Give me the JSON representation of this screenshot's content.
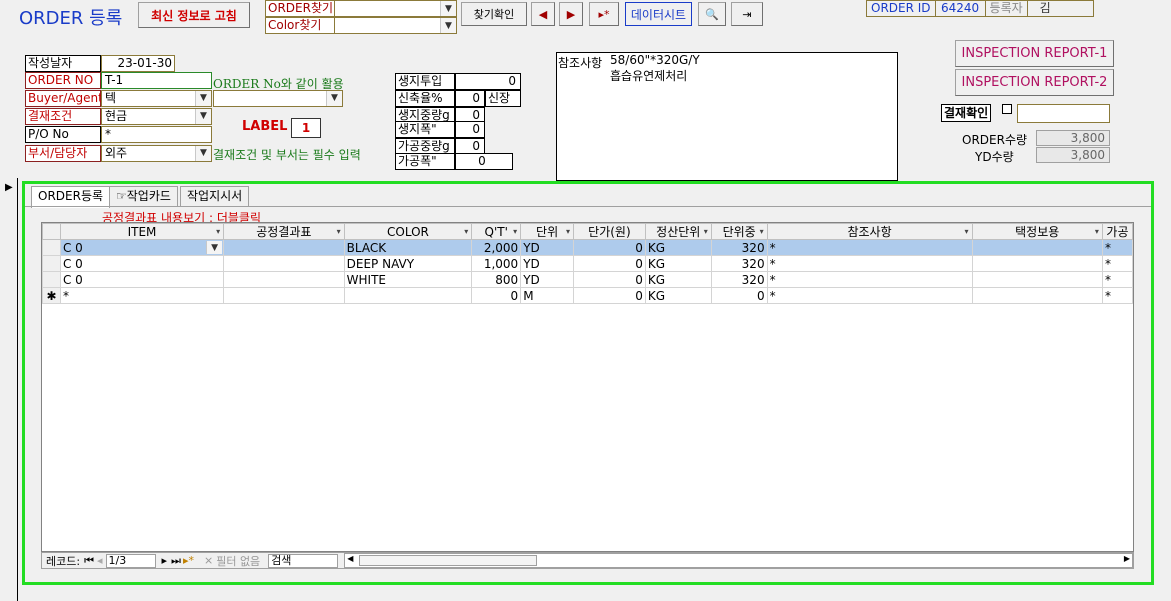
{
  "header": {
    "title": "ORDER 등록",
    "refresh_label": "최신 정보로 고침",
    "order_find_label": "ORDER찾기",
    "color_find_label": "Color찾기",
    "find_confirm_label": "찾기확인",
    "datasheet_label": "데이터시트",
    "order_id_label": "ORDER ID",
    "order_id_value": "64240",
    "registrant_label": "등록자",
    "registrant_value": "김"
  },
  "form": {
    "date_label": "작성날자",
    "date_value": "23-01-30",
    "order_no_label": "ORDER NO",
    "order_no_value": "T-1",
    "order_no_note": "ORDER No와 같이 활용",
    "buyer_label": "Buyer/Agent",
    "buyer_value": "텍",
    "payment_label": "결재조건",
    "payment_value": "현금",
    "po_label": "P/O No",
    "po_value": "*",
    "dept_label": "부서/담당자",
    "dept_value": "외주",
    "required_note": "결재조건 및 부서는 필수 입력",
    "label_text": "LABEL",
    "label_value": "1"
  },
  "spec": {
    "items": [
      {
        "label": "생지투입",
        "value": "0"
      },
      {
        "label": "신축율%",
        "value": "0",
        "extra": "신장"
      },
      {
        "label": "생지중량g",
        "value": "0"
      },
      {
        "label": "생지폭\"",
        "value": "0"
      },
      {
        "label": "가공중량g",
        "value": "0"
      },
      {
        "label": "가공폭\"",
        "value": "0"
      }
    ]
  },
  "remarks": {
    "label": "참조사항",
    "line1": "58/60\"*320G/Y",
    "line2": "흡습유연제처리"
  },
  "right": {
    "report1": "INSPECTION REPORT-1",
    "report2": "INSPECTION REPORT-2",
    "approval_label": "결재확인",
    "order_qty_label": "ORDER수량",
    "order_qty_value": "3,800",
    "yd_qty_label": "YD수량",
    "yd_qty_value": "3,800"
  },
  "tabs": [
    {
      "label": "ORDER등록"
    },
    {
      "label": "작업카드"
    },
    {
      "label": "작업지시서"
    }
  ],
  "grid": {
    "hint": "공정결과표 내용보기 : 더블클릭",
    "columns": [
      "ITEM",
      "공정결과표",
      "COLOR",
      "Q'T'",
      "단위",
      "단가(원)",
      "정산단위",
      "단위중",
      "참조사항",
      "택정보용",
      "가공"
    ],
    "rows": [
      {
        "item": "C 0",
        "process": "",
        "color": "BLACK",
        "qty": "2,000",
        "unit": "YD",
        "price": "0",
        "settle": "KG",
        "weight": "320",
        "remark": "*",
        "tag": "",
        "proc2": "*"
      },
      {
        "item": "C 0",
        "process": "",
        "color": "DEEP NAVY",
        "qty": "1,000",
        "unit": "YD",
        "price": "0",
        "settle": "KG",
        "weight": "320",
        "remark": "*",
        "tag": "",
        "proc2": "*"
      },
      {
        "item": "C 0",
        "process": "",
        "color": "WHITE",
        "qty": "800",
        "unit": "YD",
        "price": "0",
        "settle": "KG",
        "weight": "320",
        "remark": "*",
        "tag": "",
        "proc2": "*"
      },
      {
        "item": "*",
        "process": "",
        "color": "",
        "qty": "0",
        "unit": "M",
        "price": "0",
        "settle": "KG",
        "weight": "0",
        "remark": "*",
        "tag": "",
        "proc2": "*"
      }
    ]
  },
  "status": {
    "record_label": "레코드:",
    "record_position": "1/3",
    "filter_label": "필터 없음",
    "search_label": "검색"
  },
  "colors": {
    "frame_green": "#22dd22",
    "title_blue": "#1a3cc8",
    "selected_row": "#aecbec",
    "report_text": "#b01060"
  }
}
